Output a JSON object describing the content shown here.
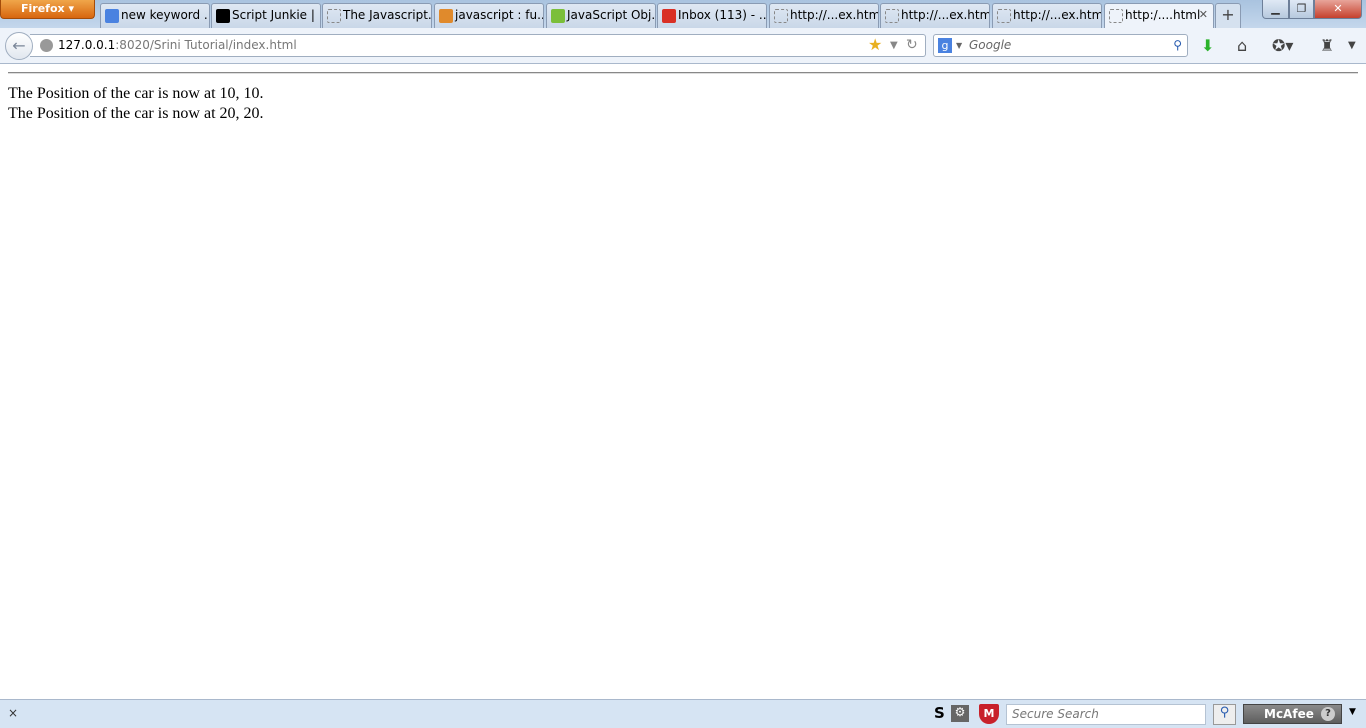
{
  "browser": {
    "menu_label": "Firefox ▾"
  },
  "tabs": [
    {
      "label": "new keyword ...",
      "icon": "google-icon",
      "color": "#4a82e0"
    },
    {
      "label": "Script Junkie | ...",
      "icon": "script-junkie-icon",
      "color": "#000000"
    },
    {
      "label": "The Javascript...",
      "icon": "blank-page-icon",
      "color": ""
    },
    {
      "label": "javascript : fu...",
      "icon": "stackoverflow-icon",
      "color": "#e08a2c"
    },
    {
      "label": "JavaScript Obj...",
      "icon": "w3-icon",
      "color": "#7bbf3a"
    },
    {
      "label": "Inbox (113) - ...",
      "icon": "gmail-icon",
      "color": "#d93025"
    },
    {
      "label": "http://...ex.html",
      "icon": "blank-page-icon",
      "color": ""
    },
    {
      "label": "http://...ex.html",
      "icon": "blank-page-icon",
      "color": ""
    },
    {
      "label": "http://...ex.html",
      "icon": "blank-page-icon",
      "color": ""
    },
    {
      "label": "http:/....html",
      "icon": "blank-page-icon",
      "color": "",
      "active": true
    }
  ],
  "address": {
    "host": "127.0.0.1",
    "rest": ":8020/Srini Tutorial/index.html"
  },
  "search": {
    "placeholder": "Google"
  },
  "page": {
    "lines": [
      "The Position of the car is now at 10, 10.",
      "The Position of the car is now at 20, 20."
    ]
  },
  "statusbar": {
    "close": "×",
    "secure_search_placeholder": "Secure Search",
    "mcafee_label": "McAfee"
  }
}
